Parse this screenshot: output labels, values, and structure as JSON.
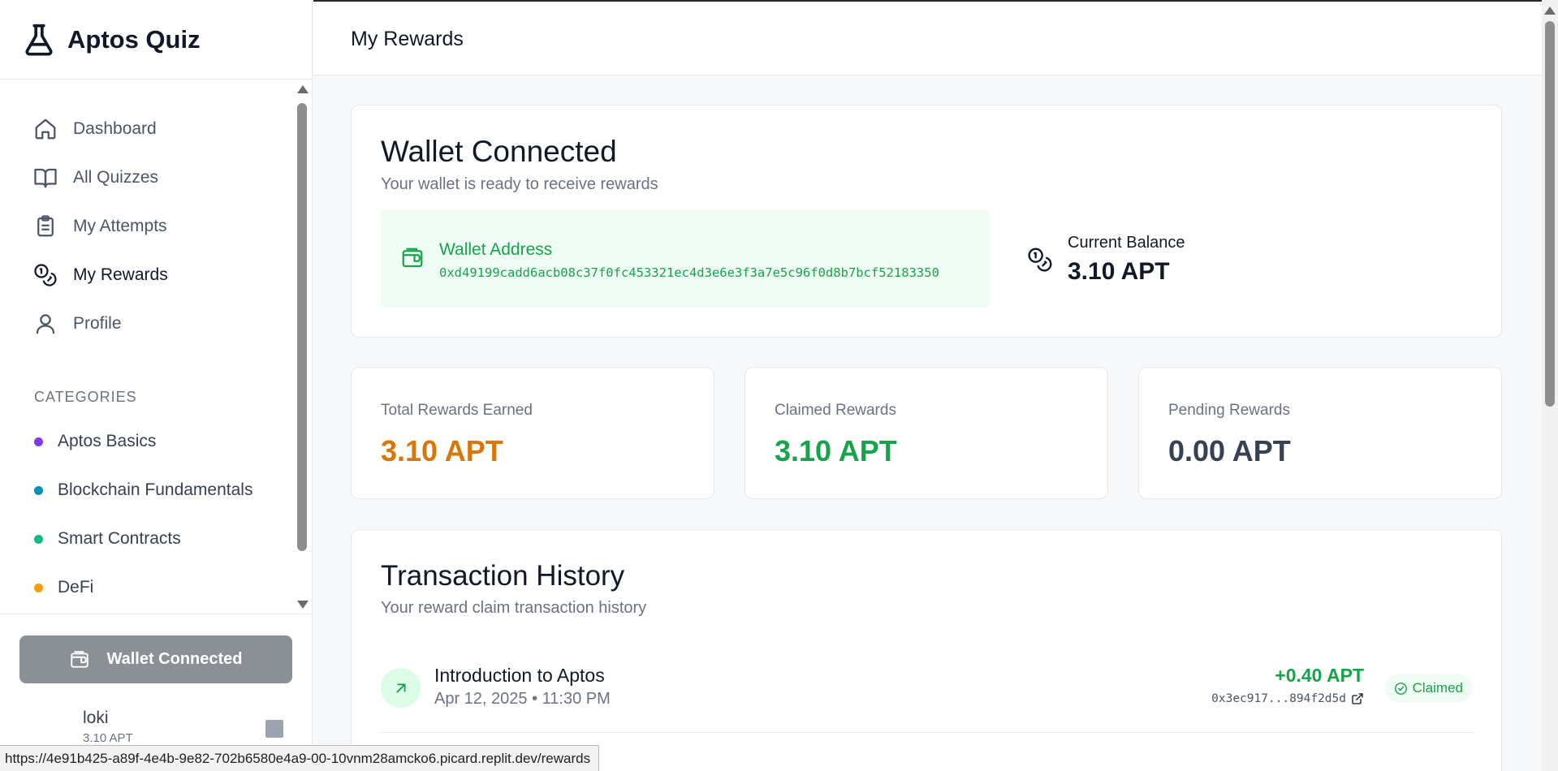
{
  "app": {
    "name": "Aptos Quiz"
  },
  "sidebar": {
    "nav": [
      {
        "label": "Dashboard",
        "icon": "home-icon"
      },
      {
        "label": "All Quizzes",
        "icon": "book-open-icon"
      },
      {
        "label": "My Attempts",
        "icon": "clipboard-list-icon"
      },
      {
        "label": "My Rewards",
        "icon": "coins-icon",
        "active": true
      },
      {
        "label": "Profile",
        "icon": "user-icon"
      }
    ],
    "categories_title": "CATEGORIES",
    "categories": [
      {
        "label": "Aptos Basics",
        "color": "#7c3aed"
      },
      {
        "label": "Blockchain Fundamentals",
        "color": "#0891b2"
      },
      {
        "label": "Smart Contracts",
        "color": "#10b981"
      },
      {
        "label": "DeFi",
        "color": "#f59e0b"
      }
    ],
    "wallet_button": "Wallet Connected",
    "user": {
      "name": "loki",
      "balance": "3.10 APT"
    }
  },
  "header": {
    "title": "My Rewards"
  },
  "wallet": {
    "title": "Wallet Connected",
    "subtitle": "Your wallet is ready to receive rewards",
    "address_label": "Wallet Address",
    "address": "0xd49199cadd6acb08c37f0fc453321ec4d3e6e3f3a7e5c96f0d8b7bcf52183350",
    "balance_label": "Current Balance",
    "balance": "3.10 APT"
  },
  "stats": {
    "total": {
      "label": "Total Rewards Earned",
      "value": "3.10 APT",
      "color": "#d97706"
    },
    "claimed": {
      "label": "Claimed Rewards",
      "value": "3.10 APT",
      "color": "#16a34a"
    },
    "pending": {
      "label": "Pending Rewards",
      "value": "0.00 APT",
      "color": "#374151"
    }
  },
  "transactions": {
    "title": "Transaction History",
    "subtitle": "Your reward claim transaction history",
    "items": [
      {
        "name": "Introduction to Aptos",
        "date": "Apr 12, 2025 • 11:30 PM",
        "amount": "+0.40 APT",
        "hash": "0x3ec917...894f2d5d",
        "status": "Claimed"
      }
    ]
  },
  "statusbar": {
    "url": "https://4e91b425-a89f-4e4b-9e82-702b6580e4a9-00-10vnm28amcko6.picard.replit.dev/rewards"
  }
}
